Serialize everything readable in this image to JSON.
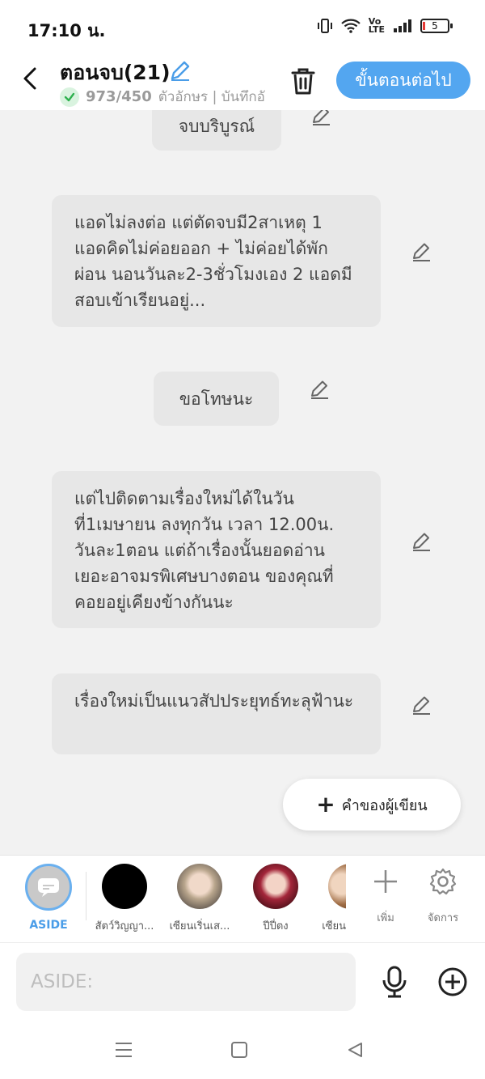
{
  "status_bar": {
    "time": "17:10 น.",
    "battery": "5"
  },
  "header": {
    "title": "ตอนจบ(21)",
    "char_count": "973/450",
    "char_unit": "ตัวอักษร | บันทึกอั",
    "next_label": "ขั้นตอนต่อไป"
  },
  "messages": [
    {
      "text": "จบบริบูรณ์"
    },
    {
      "text": "แอดไม่ลงต่อ แต่ตัดจบมี2สาเหตุ 1 แอดคิดไม่ค่อยออก + ไม่ค่อยได้พักผ่อน นอนวันละ2-3ชั่วโมงเอง 2 แอดมีสอบเข้าเรียนอยู่..."
    },
    {
      "text": "ขอโทษนะ"
    },
    {
      "text": "แต่ไปติดตามเรื่องใหม่ได้ในวันที่1เมษายน ลงทุกวัน เวลา 12.00น. วันละ1ตอน แต่ถ้าเรื่องนั้นยอดอ่านเยอะอาจมรพิเศษบางตอน ของคุณที่คอยอยู่เคียงข้างกันนะ"
    },
    {
      "text": "เรื่องใหม่เป็นแนวสัปประยุทธ์ทะลุฟ้านะ"
    }
  ],
  "author_note_label": "คำของผู้เขียน",
  "characters": [
    {
      "name": "ASIDE"
    },
    {
      "name": "สัตว์วิญญา..."
    },
    {
      "name": "เซียนเริ่นเส..."
    },
    {
      "name": "ปีปี่ตง"
    },
    {
      "name": "เซียน"
    }
  ],
  "tools": {
    "add_label": "เพิ่ม",
    "manage_label": "จัดการ"
  },
  "input": {
    "placeholder": "ASIDE:"
  },
  "colors": {
    "accent": "#53a6f0",
    "bubble": "#e7e7e7",
    "background": "#f2f2f2"
  }
}
